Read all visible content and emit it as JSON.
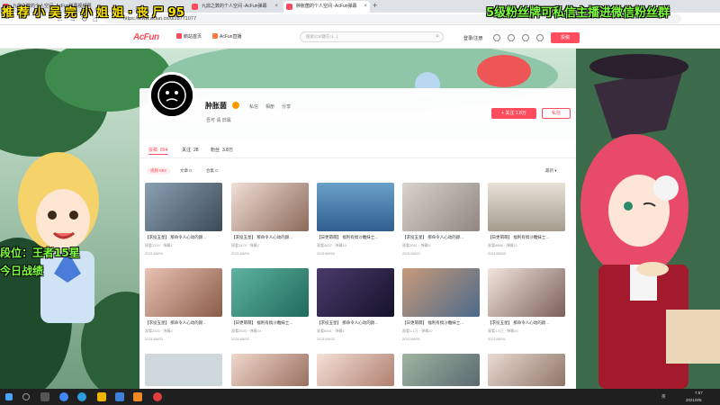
{
  "browser": {
    "tabs": [
      {
        "label": "九鼎之数的个人空间 -AcFun弹幕视频网",
        "active": false,
        "color": "#fd4c5d"
      },
      {
        "label": "九鼎之数的个人空间 -AcFun弹幕",
        "active": false,
        "color": "#fd4c5d"
      },
      {
        "label": "肿胀菌的个人空间 -AcFun弹幕",
        "active": true,
        "color": "#fd4c5d"
      }
    ],
    "new_tab": "+",
    "url": "https://www.acfun.cn/u/28771077",
    "nav": {
      "back": "←",
      "forward": "→",
      "reload": "↻",
      "home": "⌂"
    }
  },
  "site": {
    "logo": "AcFun",
    "nav": [
      "鹅站首页",
      "AcFun直播"
    ],
    "search_placeholder": "搜索(Ctrl键在ct...)",
    "header_links": [
      "登录/注册"
    ],
    "post_label": "投稿",
    "accent": "#fd4c5d"
  },
  "profile": {
    "name": "肿胀菌",
    "links": [
      "私信",
      "相册",
      "分享"
    ],
    "signature": "吾可 请 旧属",
    "follow_label": "+ 关注 1.8万",
    "message_label": "私信"
  },
  "content": {
    "tabs": [
      {
        "label": "投稿",
        "count": "894"
      },
      {
        "label": "关注",
        "count": "28"
      },
      {
        "label": "粉丝",
        "count": "3.8万"
      }
    ],
    "subtabs": [
      "视频 894",
      "文章 0",
      "合集 0"
    ],
    "sort_label": "最新 ▾",
    "videos": [
      {
        "title": "【求投五星】 那命令人心动的颜...",
        "meta": "观看1210 · 弹幕1",
        "date": "2021/08/04"
      },
      {
        "title": "【求投五星】 那命令人心动的颜...",
        "meta": "观看1474 · 弹幕2",
        "date": "2021/08/04"
      },
      {
        "title": "【日更萌萌】 福利有搞沙雕妹士...",
        "meta": "观看4637 · 弹幕10",
        "date": "2021/08/04"
      },
      {
        "title": "【求投五星】 那命令人心动的颜...",
        "meta": "观看2061 · 弹幕5",
        "date": "2021/08/01"
      },
      {
        "title": "【日更萌萌】 福利有搞沙雕妹士...",
        "meta": "观看6866 · 弹幕12",
        "date": "2021/08/03"
      },
      {
        "title": "【求投五星】 那命令人心动的颜...",
        "meta": "观看2322 · 弹幕2",
        "date": "2021/08/03"
      },
      {
        "title": "【日更萌萌】 福利有搞沙雕妹士...",
        "meta": "观看2533 · 弹幕24",
        "date": "2021/08/02"
      },
      {
        "title": "【求投五星】 那命令人心动的颜...",
        "meta": "观看6651 · 弹幕1",
        "date": "2021/08/02"
      },
      {
        "title": "【日更萌萌】 福利有搞沙雕妹士...",
        "meta": "观看1.1万 · 弹幕22",
        "date": "2021/08/01"
      },
      {
        "title": "【求投五星】 那命令人心动的颜...",
        "meta": "观看1.4万 · 弹幕10",
        "date": "2021/08/01"
      }
    ]
  },
  "overlays": {
    "top_left": "推 荐 小 吴 完 小 姐 姐 · 丧 尸 95",
    "top_right": "5级粉丝牌可私信主播进微信粉丝群",
    "left_1": "段位：王者15星",
    "left_2": "今日战绩"
  },
  "taskbar": {
    "time": "7:57",
    "date": "2021/8/5",
    "lang": "英"
  }
}
